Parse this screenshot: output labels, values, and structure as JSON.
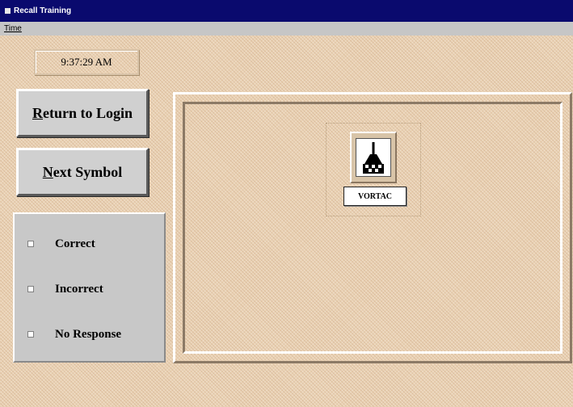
{
  "window": {
    "title": "Recall Training"
  },
  "menu": {
    "items": [
      {
        "label": "Time"
      }
    ]
  },
  "clock": {
    "time": "9:37:29 AM"
  },
  "buttons": {
    "return_login": {
      "mnemonic": "R",
      "rest": "eturn to Login"
    },
    "next_symbol": {
      "mnemonic": "N",
      "rest": "ext Symbol"
    }
  },
  "responses": [
    {
      "label": "Correct"
    },
    {
      "label": "Incorrect"
    },
    {
      "label": "No Response"
    }
  ],
  "symbol": {
    "label": "VORTAC",
    "icon": "vortac-icon"
  }
}
